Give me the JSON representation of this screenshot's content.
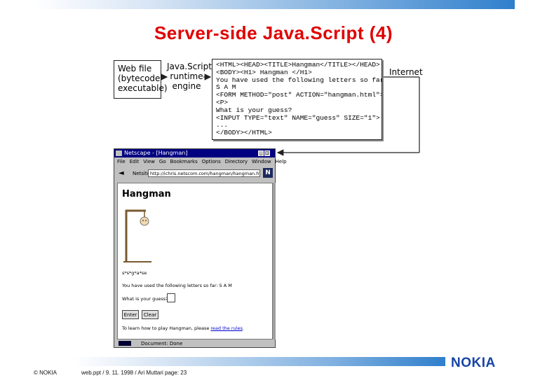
{
  "slide": {
    "title": "Server-side Java.Script (4)"
  },
  "diagram": {
    "web_file_lines": [
      "Web file",
      "(bytecode",
      "executable)"
    ],
    "engine_lines": [
      "Java.Script",
      "runtime",
      "engine"
    ],
    "internet_label": "Internet",
    "code_lines": [
      "<HTML><HEAD><TITLE>Hangman</TITLE></HEAD>",
      "<BODY><H1> Hangman </H1>",
      "You have used the following letters so far",
      "S A M",
      "<FORM METHOD=\"post\" ACTION=\"hangman.html\">",
      "<P>",
      "What is your guess?",
      "<INPUT TYPE=\"text\" NAME=\"guess\" SIZE=\"1\">",
      "...",
      "</BODY></HTML>"
    ]
  },
  "browser": {
    "window_title": "Netscape - [Hangman]",
    "menu": [
      "File",
      "Edit",
      "View",
      "Go",
      "Bookmarks",
      "Options",
      "Directory",
      "Window",
      "Help"
    ],
    "location_label": "Netsite:",
    "url": "http://ichris.netscom.com/hangman/hangman.html",
    "logo_letter": "N",
    "page_heading": "Hangman",
    "scrambled_word": "s*s*g*a*se",
    "used_letters_text": "You have used the following letters so far: S A M",
    "guess_prompt": "What is your guess?",
    "enter_button": "Enter",
    "clear_button": "Clear",
    "learn_prefix": "To learn how to play Hangman, please",
    "learn_link": "read the rules",
    "status_text": "Document: Done"
  },
  "footer": {
    "copyright": "© NOKIA",
    "info": "web.ppt / 9. 11. 1998 / Ari Muttari   page: 23",
    "brand": "NOKIA"
  }
}
